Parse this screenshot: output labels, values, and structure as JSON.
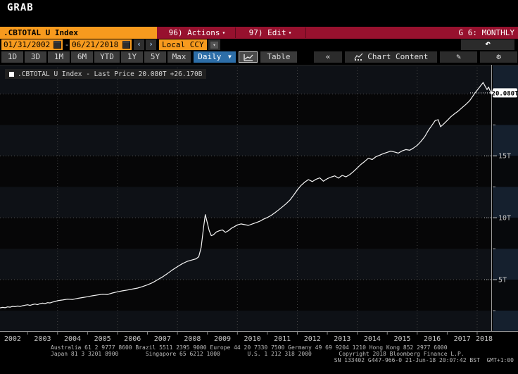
{
  "window": {
    "title": "GRAB"
  },
  "command_bar": {
    "ticker": ".CBTOTAL U Index",
    "actions_label": "96) Actions",
    "edit_label": "97) Edit",
    "panel_label": "G 6: MONTHLY"
  },
  "date_bar": {
    "start_date": "01/31/2002",
    "separator": "-",
    "end_date": "06/21/2018",
    "currency": "Local CCY"
  },
  "toolbar": {
    "ranges": [
      "1D",
      "3D",
      "1M",
      "6M",
      "YTD",
      "1Y",
      "5Y",
      "Max"
    ],
    "period": "Daily",
    "table_label": "Table",
    "collapse_label": "«",
    "chart_content_label": "Chart Content"
  },
  "icons": {
    "caret_down": "▼",
    "caret_small": "▾",
    "prev": "‹",
    "next": "›",
    "undo": "↶",
    "edit": "✎",
    "settings": "⚙"
  },
  "legend": {
    "series_label": ".CBTOTAL U Index - Last Price",
    "last_price": "20.080T",
    "change": "+26.170B"
  },
  "chart_data": {
    "type": "line",
    "title": ".CBTOTAL U Index - Last Price",
    "unit": "trillions (T), local currency",
    "x_start": 2002.08,
    "x_end": 2018.47,
    "x_tick_years": [
      2002,
      2003,
      2004,
      2005,
      2006,
      2007,
      2008,
      2009,
      2010,
      2011,
      2012,
      2013,
      2014,
      2015,
      2016,
      2017,
      2018
    ],
    "ylim": [
      0.85,
      22.35
    ],
    "y_ticks": [
      {
        "value": 5,
        "label": "5T"
      },
      {
        "value": 10,
        "label": "10T"
      },
      {
        "value": 15,
        "label": "15T"
      }
    ],
    "y_minor_ticks": [
      2.5,
      7.5,
      12.5,
      17.5
    ],
    "grid_v_years": [
      2004,
      2006,
      2008,
      2010,
      2012,
      2014,
      2016,
      2018
    ],
    "last_price_value": 20.08,
    "last_price_label": "20.080T",
    "legend_position": "top-left",
    "series": [
      {
        "name": ".CBTOTAL U Index",
        "color": "#f4f4f4",
        "points": [
          [
            2002.08,
            2.72
          ],
          [
            2002.17,
            2.76
          ],
          [
            2002.25,
            2.73
          ],
          [
            2002.33,
            2.8
          ],
          [
            2002.42,
            2.78
          ],
          [
            2002.5,
            2.84
          ],
          [
            2002.58,
            2.82
          ],
          [
            2002.67,
            2.87
          ],
          [
            2002.75,
            2.83
          ],
          [
            2002.83,
            2.89
          ],
          [
            2002.92,
            2.94
          ],
          [
            2003.0,
            2.97
          ],
          [
            2003.08,
            2.92
          ],
          [
            2003.17,
            2.99
          ],
          [
            2003.25,
            3.03
          ],
          [
            2003.33,
            2.98
          ],
          [
            2003.42,
            3.06
          ],
          [
            2003.5,
            3.1
          ],
          [
            2003.58,
            3.07
          ],
          [
            2003.67,
            3.14
          ],
          [
            2003.75,
            3.12
          ],
          [
            2003.83,
            3.19
          ],
          [
            2003.92,
            3.24
          ],
          [
            2004.0,
            3.3
          ],
          [
            2004.17,
            3.36
          ],
          [
            2004.33,
            3.42
          ],
          [
            2004.5,
            3.4
          ],
          [
            2004.67,
            3.49
          ],
          [
            2004.83,
            3.55
          ],
          [
            2005.0,
            3.62
          ],
          [
            2005.17,
            3.7
          ],
          [
            2005.33,
            3.76
          ],
          [
            2005.5,
            3.82
          ],
          [
            2005.67,
            3.8
          ],
          [
            2005.83,
            3.92
          ],
          [
            2006.0,
            4.02
          ],
          [
            2006.17,
            4.1
          ],
          [
            2006.33,
            4.16
          ],
          [
            2006.5,
            4.24
          ],
          [
            2006.67,
            4.32
          ],
          [
            2006.83,
            4.44
          ],
          [
            2007.0,
            4.58
          ],
          [
            2007.17,
            4.76
          ],
          [
            2007.33,
            4.98
          ],
          [
            2007.5,
            5.22
          ],
          [
            2007.67,
            5.5
          ],
          [
            2007.83,
            5.78
          ],
          [
            2008.0,
            6.05
          ],
          [
            2008.17,
            6.3
          ],
          [
            2008.33,
            6.48
          ],
          [
            2008.5,
            6.6
          ],
          [
            2008.62,
            6.68
          ],
          [
            2008.71,
            6.85
          ],
          [
            2008.79,
            7.6
          ],
          [
            2008.87,
            9.2
          ],
          [
            2008.93,
            10.25
          ],
          [
            2009.0,
            9.55
          ],
          [
            2009.06,
            8.95
          ],
          [
            2009.13,
            8.55
          ],
          [
            2009.2,
            8.62
          ],
          [
            2009.3,
            8.85
          ],
          [
            2009.4,
            8.95
          ],
          [
            2009.5,
            9.02
          ],
          [
            2009.6,
            8.82
          ],
          [
            2009.7,
            8.95
          ],
          [
            2009.8,
            9.15
          ],
          [
            2009.9,
            9.28
          ],
          [
            2010.0,
            9.42
          ],
          [
            2010.12,
            9.5
          ],
          [
            2010.25,
            9.44
          ],
          [
            2010.37,
            9.38
          ],
          [
            2010.5,
            9.5
          ],
          [
            2010.62,
            9.6
          ],
          [
            2010.75,
            9.72
          ],
          [
            2010.87,
            9.88
          ],
          [
            2011.0,
            10.02
          ],
          [
            2011.12,
            10.18
          ],
          [
            2011.25,
            10.4
          ],
          [
            2011.37,
            10.62
          ],
          [
            2011.5,
            10.88
          ],
          [
            2011.62,
            11.12
          ],
          [
            2011.75,
            11.42
          ],
          [
            2011.87,
            11.8
          ],
          [
            2012.0,
            12.25
          ],
          [
            2012.12,
            12.6
          ],
          [
            2012.25,
            12.88
          ],
          [
            2012.37,
            13.08
          ],
          [
            2012.5,
            12.92
          ],
          [
            2012.62,
            13.1
          ],
          [
            2012.75,
            13.22
          ],
          [
            2012.87,
            12.95
          ],
          [
            2013.0,
            13.15
          ],
          [
            2013.12,
            13.28
          ],
          [
            2013.25,
            13.38
          ],
          [
            2013.37,
            13.2
          ],
          [
            2013.5,
            13.42
          ],
          [
            2013.62,
            13.3
          ],
          [
            2013.75,
            13.48
          ],
          [
            2013.87,
            13.72
          ],
          [
            2014.0,
            14.02
          ],
          [
            2014.12,
            14.3
          ],
          [
            2014.25,
            14.55
          ],
          [
            2014.37,
            14.8
          ],
          [
            2014.5,
            14.7
          ],
          [
            2014.62,
            14.92
          ],
          [
            2014.75,
            15.05
          ],
          [
            2014.87,
            15.18
          ],
          [
            2015.0,
            15.28
          ],
          [
            2015.12,
            15.38
          ],
          [
            2015.25,
            15.3
          ],
          [
            2015.37,
            15.22
          ],
          [
            2015.5,
            15.4
          ],
          [
            2015.62,
            15.5
          ],
          [
            2015.75,
            15.45
          ],
          [
            2015.87,
            15.62
          ],
          [
            2016.0,
            15.85
          ],
          [
            2016.12,
            16.15
          ],
          [
            2016.25,
            16.55
          ],
          [
            2016.37,
            17.05
          ],
          [
            2016.5,
            17.5
          ],
          [
            2016.6,
            17.85
          ],
          [
            2016.7,
            17.92
          ],
          [
            2016.78,
            17.35
          ],
          [
            2016.87,
            17.55
          ],
          [
            2017.0,
            17.85
          ],
          [
            2017.12,
            18.15
          ],
          [
            2017.25,
            18.4
          ],
          [
            2017.37,
            18.62
          ],
          [
            2017.5,
            18.9
          ],
          [
            2017.62,
            19.15
          ],
          [
            2017.75,
            19.45
          ],
          [
            2017.85,
            19.8
          ],
          [
            2017.95,
            20.15
          ],
          [
            2018.05,
            20.45
          ],
          [
            2018.13,
            20.7
          ],
          [
            2018.2,
            20.92
          ],
          [
            2018.27,
            20.6
          ],
          [
            2018.33,
            20.35
          ],
          [
            2018.38,
            20.55
          ],
          [
            2018.42,
            20.3
          ],
          [
            2018.47,
            20.08
          ]
        ]
      }
    ]
  },
  "footer": {
    "line1": "Australia 61 2 9777 8600 Brazil 5511 2395 9000 Europe 44 20 7330 7500 Germany 49 69 9204 1210 Hong Kong 852 2977 6000",
    "line2": "Japan 81 3 3201 8900        Singapore 65 6212 1000        U.S. 1 212 318 2000        Copyright 2018 Bloomberg Finance L.P.",
    "line3": "SN 133402 G447-966-0 21-Jun-18 20:07:42 BST  GMT+1:00"
  },
  "colors": {
    "banner_red": "#97112e",
    "accent_orange": "#f79a1e",
    "period_blue": "#2d6ea8",
    "line_white": "#f4f4f4",
    "band_light": "#0e1116",
    "band_dark": "#060607",
    "grid_grey": "#4d4d4d"
  }
}
